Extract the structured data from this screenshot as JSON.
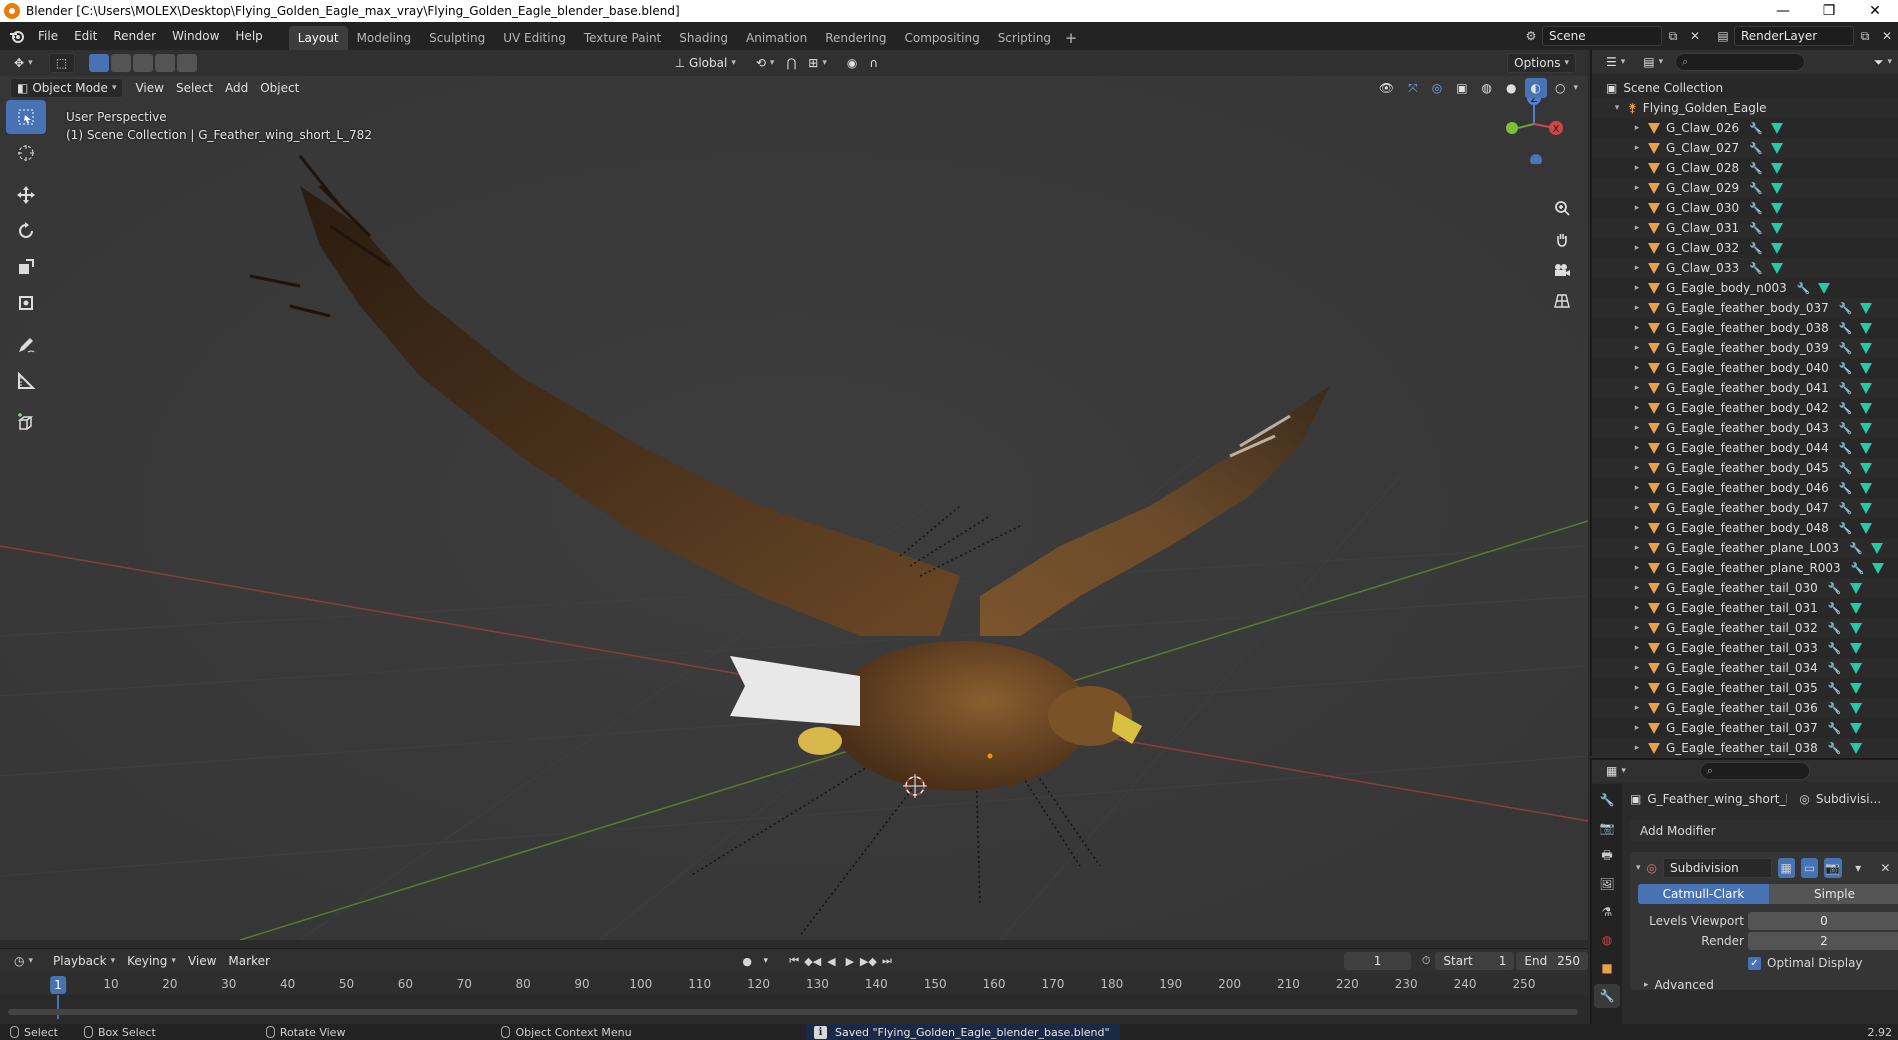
{
  "window": {
    "title": "Blender [C:\\Users\\MOLEX\\Desktop\\Flying_Golden_Eagle_max_vray\\Flying_Golden_Eagle_blender_base.blend]",
    "minimize": "—",
    "maximize": "❐",
    "close": "✕"
  },
  "menu": [
    "File",
    "Edit",
    "Render",
    "Window",
    "Help"
  ],
  "workspaces": [
    "Layout",
    "Modeling",
    "Sculpting",
    "UV Editing",
    "Texture Paint",
    "Shading",
    "Animation",
    "Rendering",
    "Compositing",
    "Scripting"
  ],
  "active_workspace": "Layout",
  "scene": {
    "name": "Scene",
    "view_layer": "RenderLayer"
  },
  "viewport_header": {
    "transform_orientation": "Global",
    "options_label": "Options",
    "mode": "Object Mode",
    "menus": [
      "View",
      "Select",
      "Add",
      "Object"
    ]
  },
  "viewport": {
    "perspective_label": "User Perspective",
    "collection_label": "(1) Scene Collection | G_Feather_wing_short_L_782",
    "gizmo_axes": {
      "z": "Z",
      "x": "X"
    }
  },
  "timeline": {
    "menus": [
      "Playback",
      "Keying",
      "View",
      "Marker"
    ],
    "current_frame": "1",
    "start_label": "Start",
    "start": "1",
    "end_label": "End",
    "end": "250",
    "ticks": [
      "1",
      "10",
      "20",
      "30",
      "40",
      "50",
      "60",
      "70",
      "80",
      "90",
      "100",
      "110",
      "120",
      "130",
      "140",
      "150",
      "160",
      "170",
      "180",
      "190",
      "200",
      "210",
      "220",
      "230",
      "240",
      "250"
    ]
  },
  "statusbar": {
    "select": "Select",
    "box_select": "Box Select",
    "rotate_view": "Rotate View",
    "context_menu": "Object Context Menu",
    "message": "Saved \"Flying_Golden_Eagle_blender_base.blend\"",
    "version": "2.92"
  },
  "outliner": {
    "root": "Scene Collection",
    "collection": "Flying_Golden_Eagle",
    "items": [
      "G_Claw_026",
      "G_Claw_027",
      "G_Claw_028",
      "G_Claw_029",
      "G_Claw_030",
      "G_Claw_031",
      "G_Claw_032",
      "G_Claw_033",
      "G_Eagle_body_n003",
      "G_Eagle_feather_body_037",
      "G_Eagle_feather_body_038",
      "G_Eagle_feather_body_039",
      "G_Eagle_feather_body_040",
      "G_Eagle_feather_body_041",
      "G_Eagle_feather_body_042",
      "G_Eagle_feather_body_043",
      "G_Eagle_feather_body_044",
      "G_Eagle_feather_body_045",
      "G_Eagle_feather_body_046",
      "G_Eagle_feather_body_047",
      "G_Eagle_feather_body_048",
      "G_Eagle_feather_plane_L003",
      "G_Eagle_feather_plane_R003",
      "G_Eagle_feather_tail_030",
      "G_Eagle_feather_tail_031",
      "G_Eagle_feather_tail_032",
      "G_Eagle_feather_tail_033",
      "G_Eagle_feather_tail_034",
      "G_Eagle_feather_tail_035",
      "G_Eagle_feather_tail_036",
      "G_Eagle_feather_tail_037",
      "G_Eagle_feather_tail_038"
    ]
  },
  "properties": {
    "object_name": "G_Feather_wing_short_L...",
    "modifier_short": "Subdivisi...",
    "add_modifier": "Add Modifier",
    "modifier_name": "Subdivision",
    "catmull": "Catmull-Clark",
    "simple": "Simple",
    "levels_viewport_label": "Levels Viewport",
    "levels_viewport": "0",
    "render_label": "Render",
    "render": "2",
    "optimal_display": "Optimal Display",
    "advanced": "Advanced"
  },
  "colors": {
    "accent": "#4772b3",
    "object_orange": "#e8a04a",
    "mesh_green": "#26c9a0",
    "viewport_bg": "#393939"
  }
}
